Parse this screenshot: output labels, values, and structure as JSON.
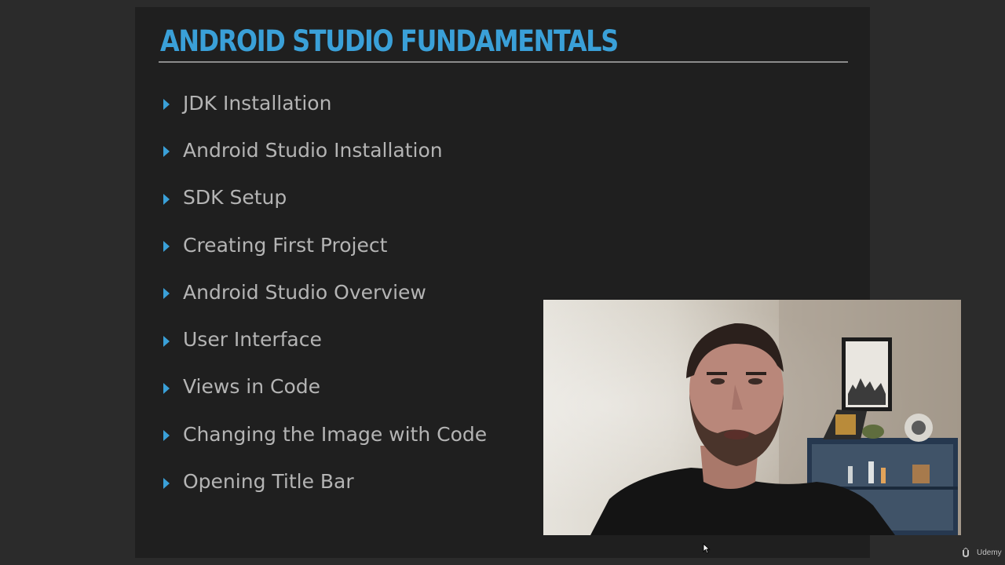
{
  "slide": {
    "title": "ANDROID STUDIO FUNDAMENTALS",
    "accent_color": "#3aa0d8",
    "bullets": [
      "JDK Installation",
      "Android Studio Installation",
      "SDK Setup",
      "Creating First Project",
      "Android Studio Overview",
      "User Interface",
      "Views in Code",
      "Changing the Image with Code",
      "Opening Title Bar"
    ]
  },
  "webcam": {
    "icon": "presenter-video-icon"
  },
  "cursor": {
    "icon": "mouse-cursor-icon"
  },
  "watermark": {
    "icon": "udemy-logo-icon",
    "label": "Udemy"
  }
}
